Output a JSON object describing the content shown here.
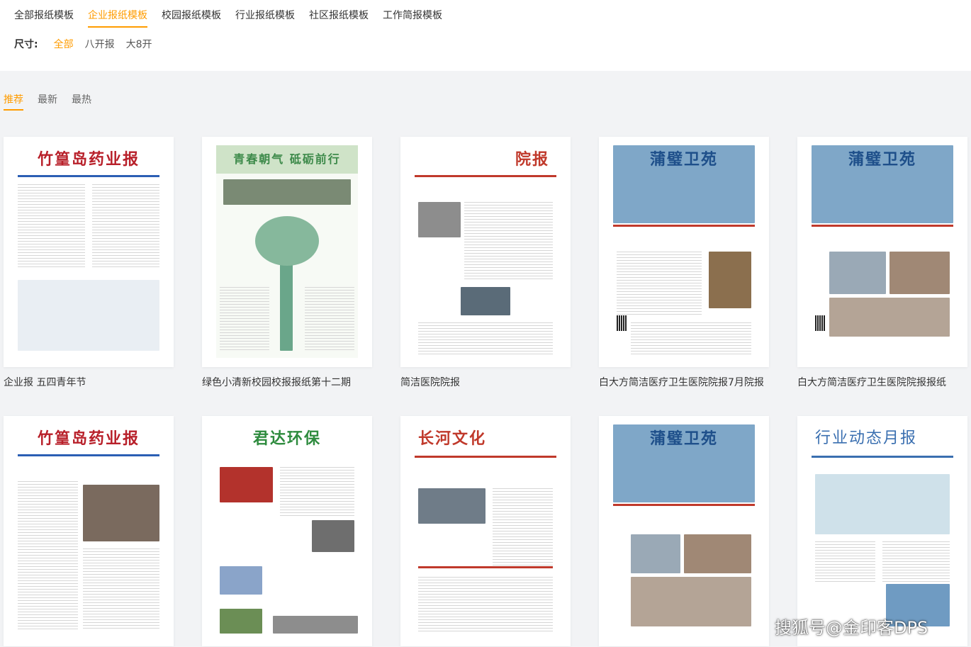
{
  "categories": [
    "全部报纸模板",
    "企业报纸模板",
    "校园报纸模板",
    "行业报纸模板",
    "社区报纸模板",
    "工作简报模板"
  ],
  "active_category": "企业报纸模板",
  "size": {
    "label": "尺寸:",
    "options": [
      "全部",
      "八开报",
      "大8开"
    ],
    "active": "全部"
  },
  "sort": {
    "options": [
      "推荐",
      "最新",
      "最热"
    ],
    "active": "推荐"
  },
  "cards": [
    {
      "title": "企业报 五四青年节",
      "mast": "竹篁岛药业报"
    },
    {
      "title": "绿色小清新校园校报报纸第十二期",
      "mast": "青春朝气 砥砺前行"
    },
    {
      "title": "简洁医院院报",
      "mast": "院报"
    },
    {
      "title": "白大方简洁医疗卫生医院院报7月院报",
      "mast": "蒲璧卫苑"
    },
    {
      "title": "白大方简洁医疗卫生医院院报报纸",
      "mast": "蒲璧卫苑"
    },
    {
      "title": "",
      "mast": "竹篁岛药业报"
    },
    {
      "title": "",
      "mast": "君达环保"
    },
    {
      "title": "",
      "mast": "长河文化"
    },
    {
      "title": "",
      "mast": "蒲璧卫苑"
    },
    {
      "title": "",
      "mast": "行业动态月报"
    }
  ],
  "colors": {
    "accent": "#ff9c00"
  },
  "watermark": "搜狐号@金印客DPS"
}
